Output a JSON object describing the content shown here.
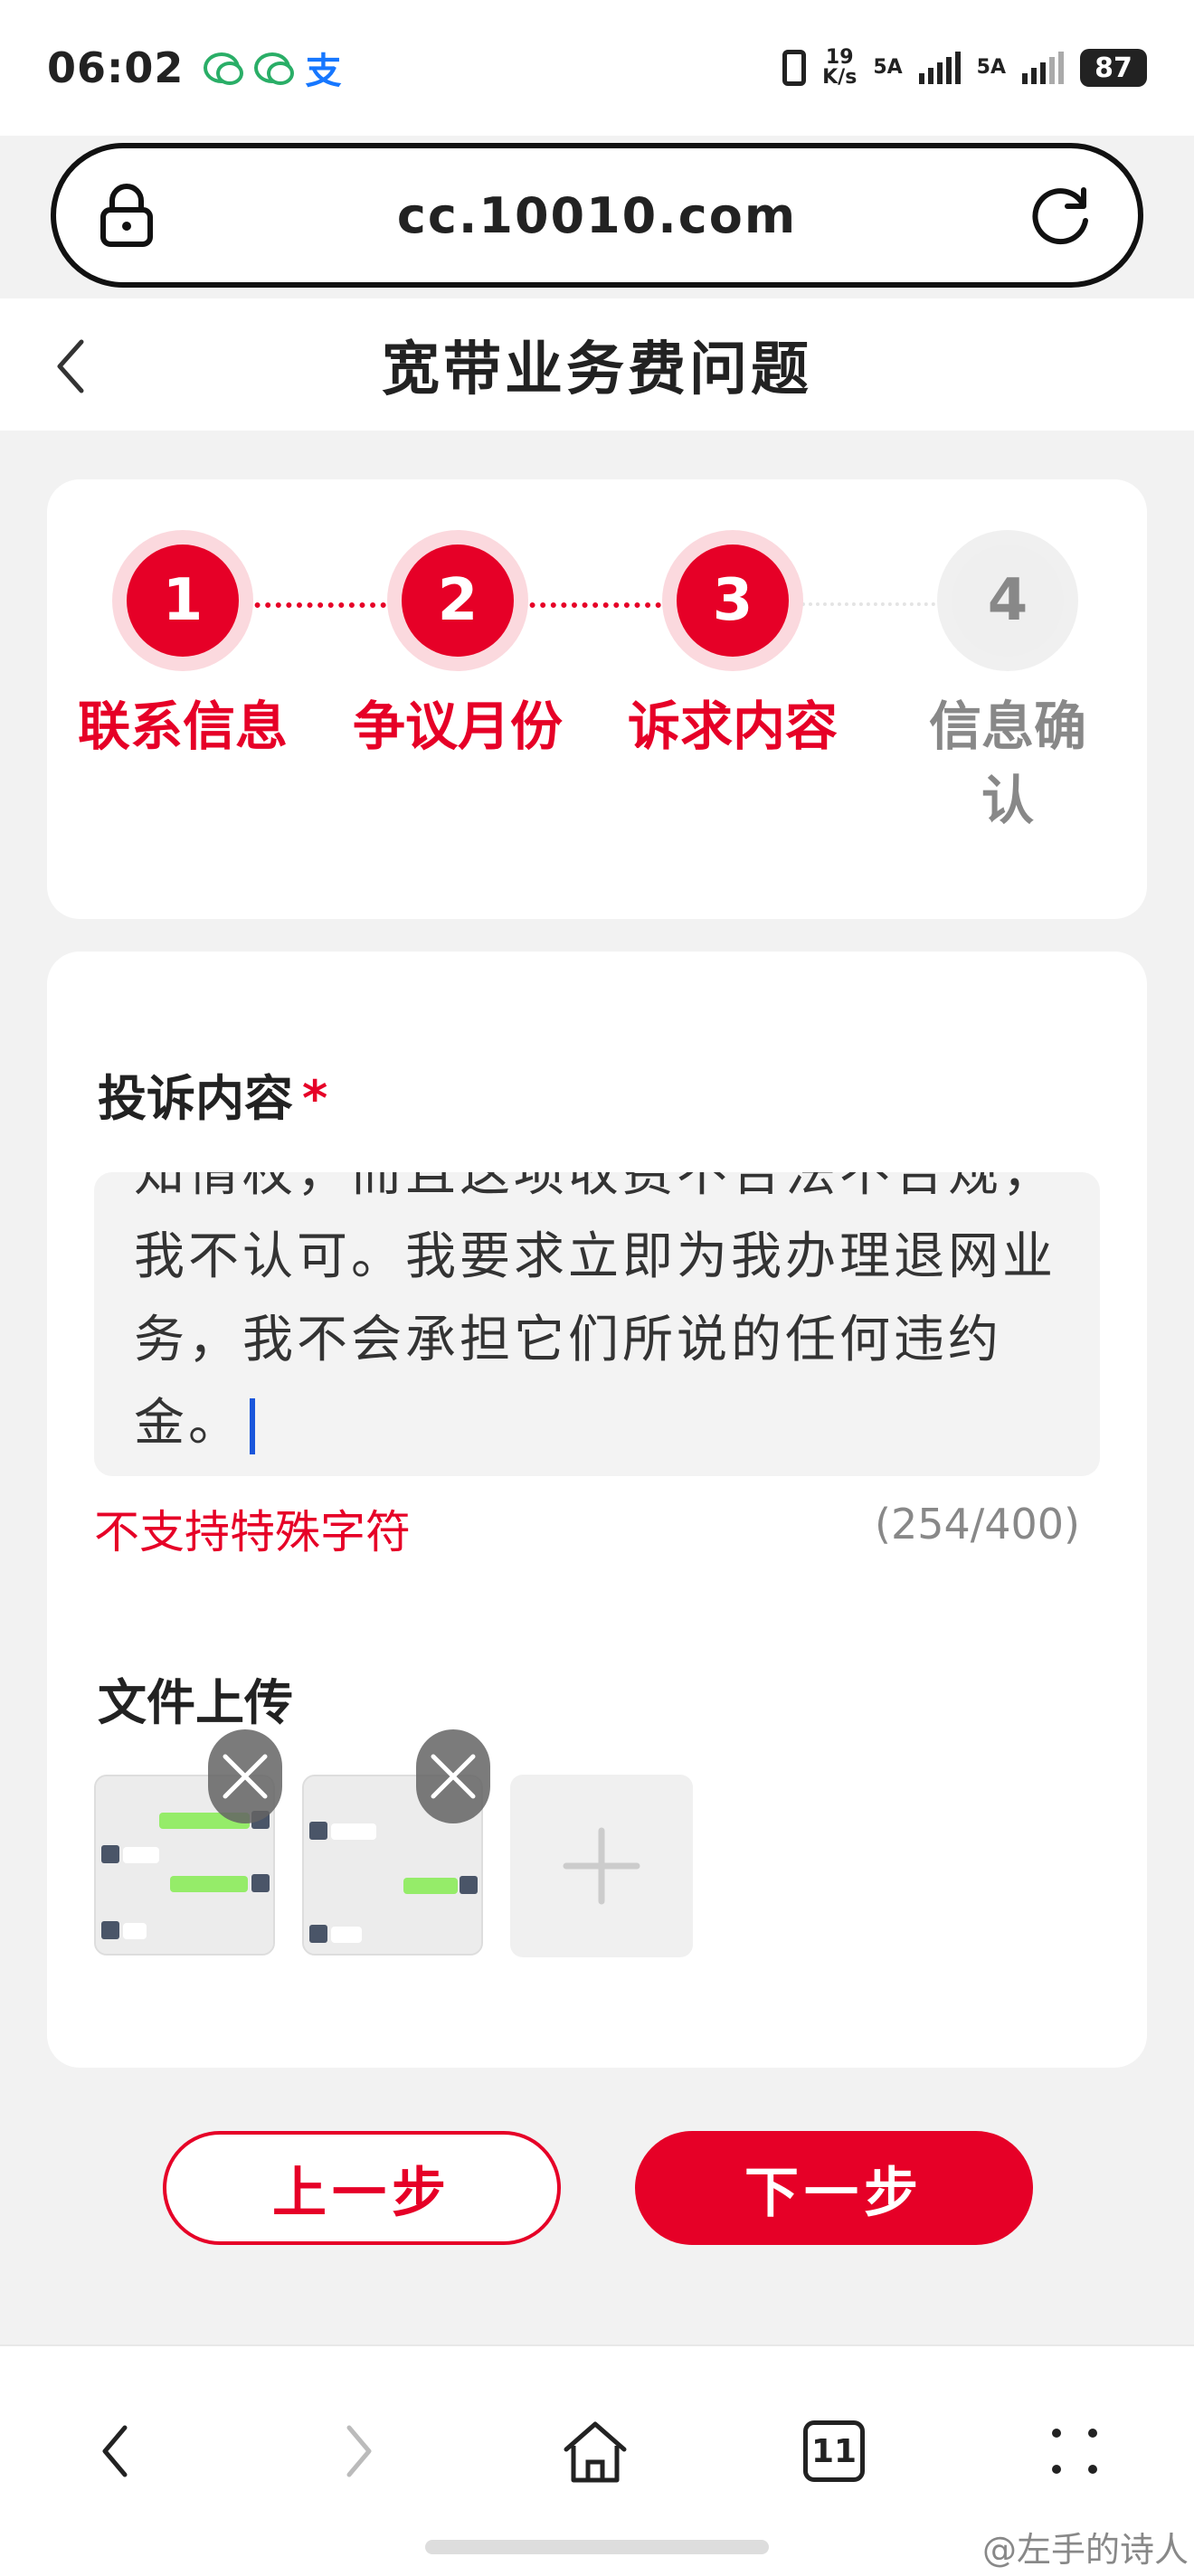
{
  "status_bar": {
    "time": "06:02",
    "net_speed_value": "19",
    "net_speed_unit": "K/s",
    "signal1_label": "5A",
    "signal2_label": "5A",
    "battery": "87"
  },
  "browser": {
    "url": "cc.10010.com"
  },
  "header": {
    "title": "宽带业务费问题"
  },
  "steps": [
    {
      "number": "1",
      "label": "联系信息",
      "active": true
    },
    {
      "number": "2",
      "label": "争议月份",
      "active": true
    },
    {
      "number": "3",
      "label": "诉求内容",
      "active": true
    },
    {
      "number": "4",
      "label": "信息确认",
      "active": false
    }
  ],
  "form": {
    "complaint_label": "投诉内容",
    "required_mark": "*",
    "complaint_text_visible": "知情权，而且这项收费不合法不合规，我不认可。我要求立即为我办理退网业务，我不会承担它们所说的任何违约金。",
    "hint": "不支持特殊字符",
    "counter": "(254/400)",
    "upload_label": "文件上传"
  },
  "buttons": {
    "prev": "上一步",
    "next": "下一步"
  },
  "bottom_nav": {
    "tab_count": "11"
  },
  "watermark": "@左手的诗人"
}
